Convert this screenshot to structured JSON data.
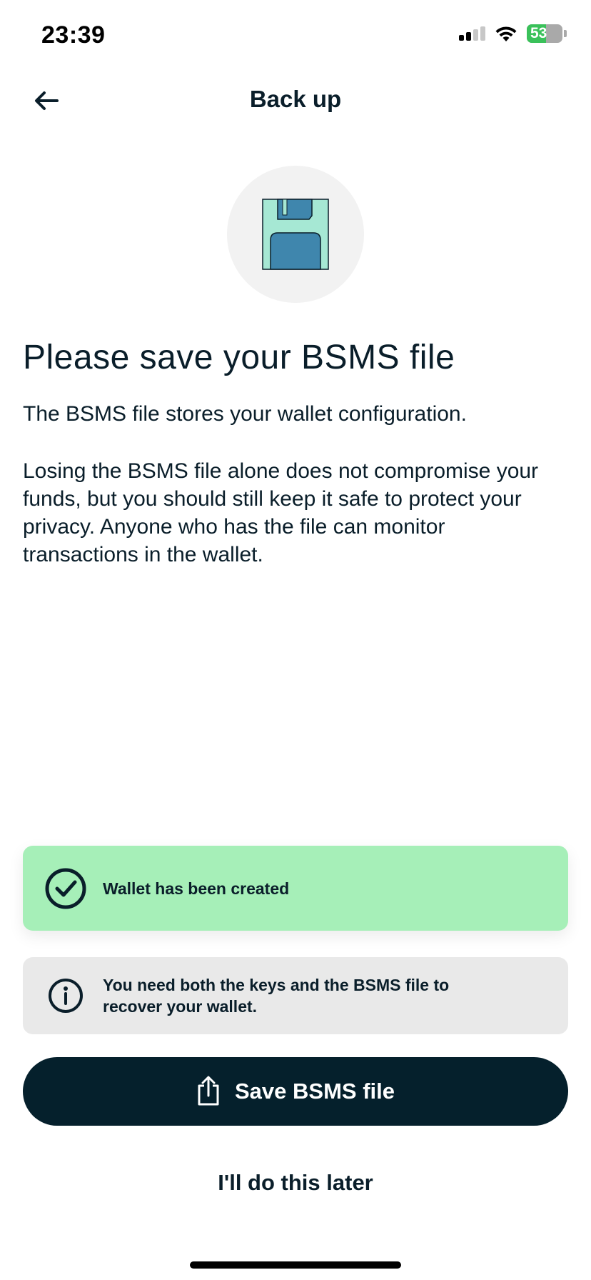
{
  "status_bar": {
    "time": "23:39",
    "battery": "53",
    "battery_level": 0.53,
    "icons": [
      "cellular-signal-icon",
      "wifi-icon",
      "battery-charging-icon"
    ]
  },
  "nav": {
    "title": "Back up",
    "back_icon": "arrow-left-icon"
  },
  "hero": {
    "icon": "floppy-disk-icon"
  },
  "content": {
    "title": "Please save your BSMS file",
    "paragraph1": "The BSMS file stores your wallet configuration.",
    "paragraph2": "Losing the BSMS file alone does not compromise your funds, but you should still keep it safe to protect your privacy. Anyone who has the file can monitor transactions in the wallet."
  },
  "notices": {
    "success": {
      "text": "Wallet has been created",
      "icon": "check-circle-icon"
    },
    "info": {
      "text": "You need both the keys and the BSMS file to recover your wallet.",
      "icon": "info-circle-icon"
    }
  },
  "actions": {
    "save_label": "Save BSMS file",
    "save_icon": "share-icon",
    "later_label": "I'll do this later"
  },
  "colors": {
    "primary": "#05202c",
    "success_bg": "#a6efb8",
    "info_bg": "#e9e9e9",
    "floppy_body": "#a6e8d4",
    "floppy_accent": "#3f86ad"
  }
}
